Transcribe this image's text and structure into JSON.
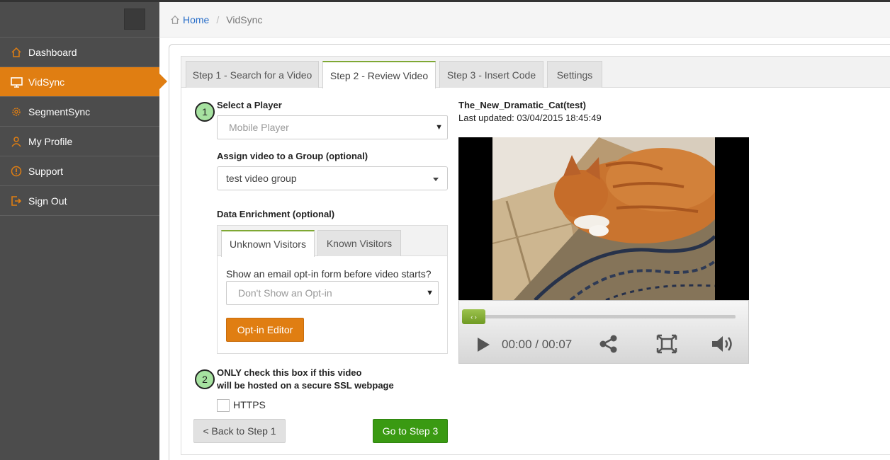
{
  "sidebar": {
    "items": [
      {
        "label": "Dashboard",
        "icon": "home-icon",
        "active": false
      },
      {
        "label": "VidSync",
        "icon": "monitor-icon",
        "active": true
      },
      {
        "label": "SegmentSync",
        "icon": "gear-icon",
        "active": false
      },
      {
        "label": "My Profile",
        "icon": "user-icon",
        "active": false
      },
      {
        "label": "Support",
        "icon": "alert-icon",
        "active": false
      },
      {
        "label": "Sign Out",
        "icon": "sign-out-icon",
        "active": false
      }
    ]
  },
  "breadcrumb": {
    "home": "Home",
    "separator": "/",
    "current": "VidSync"
  },
  "tabs": [
    {
      "label": "Step 1 - Search for a Video"
    },
    {
      "label": "Step 2 - Review Video"
    },
    {
      "label": "Step 3 - Insert Code"
    },
    {
      "label": "Settings"
    }
  ],
  "form": {
    "step1_number": "1",
    "player_label": "Select a Player",
    "player_value": "Mobile Player",
    "group_label": "Assign video to a Group (optional)",
    "group_value": "test video group",
    "enrichment_label": "Data Enrichment (optional)",
    "enrichment_tabs": [
      {
        "label": "Unknown Visitors"
      },
      {
        "label": "Known Visitors"
      }
    ],
    "optin_question": "Show an email opt-in form before video starts?",
    "optin_value": "Don't Show an Opt-in",
    "optin_button": "Opt-in Editor",
    "step2_number": "2",
    "ssl_line1": "ONLY check this box if this video",
    "ssl_line2": "will be hosted on a secure SSL webpage",
    "https_label": "HTTPS",
    "back_button": "< Back to Step 1",
    "next_button": "Go to Step 3"
  },
  "video": {
    "title": "The_New_Dramatic_Cat(test)",
    "updated": "Last updated: 03/04/2015 18:45:49",
    "time": "00:00 / 00:07",
    "seek_handle": "‹ ›"
  },
  "colors": {
    "accent": "#e07e12",
    "sidebar": "#4c4c4c",
    "go_green": "#3a9a12",
    "tab_border": "#7fa834"
  }
}
